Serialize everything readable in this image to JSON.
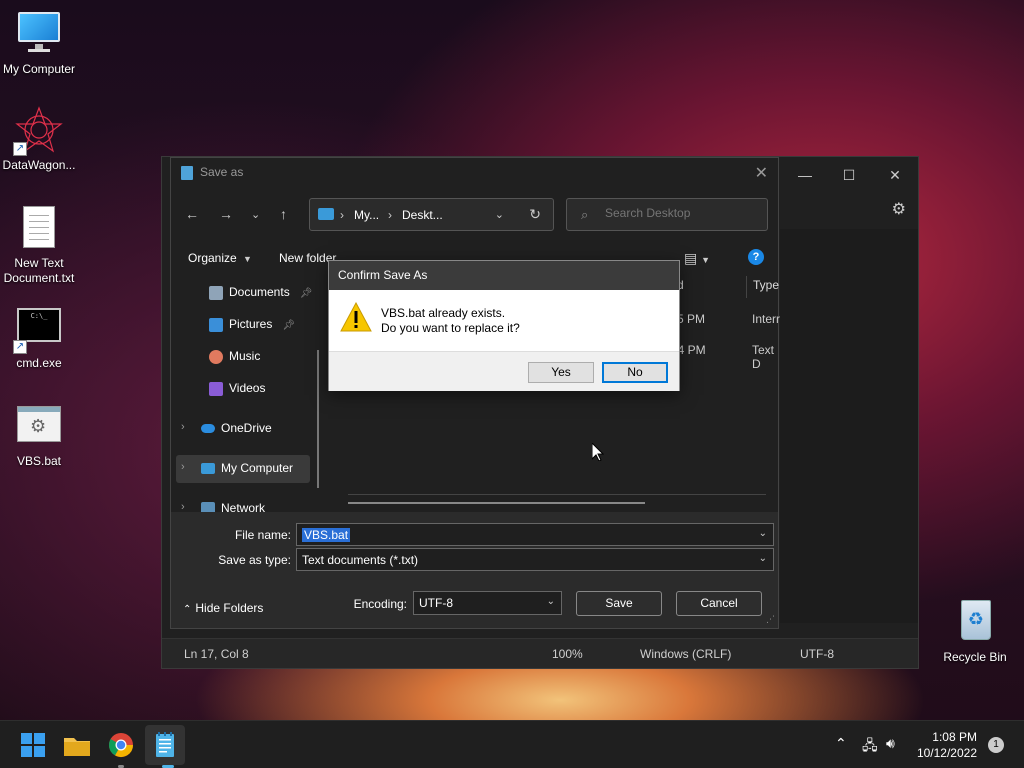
{
  "desktop": {
    "icons": [
      {
        "label": "My Computer"
      },
      {
        "label": "DataWagon..."
      },
      {
        "label": "New Text Document.txt"
      },
      {
        "label": "cmd.exe"
      },
      {
        "label": "VBS.bat"
      },
      {
        "label": "Recycle Bin"
      }
    ]
  },
  "notepad": {
    "status": {
      "position": "Ln 17, Col 8",
      "zoom": "100%",
      "line_ending": "Windows (CRLF)",
      "encoding": "UTF-8"
    }
  },
  "save_as": {
    "title": "Save as",
    "address": {
      "seg1": "My...",
      "seg2": "Deskt..."
    },
    "search_placeholder": "Search Desktop",
    "organize": "Organize",
    "new_folder": "New folder",
    "nav": {
      "documents": "Documents",
      "pictures": "Pictures",
      "music": "Music",
      "videos": "Videos",
      "onedrive": "OneDrive",
      "my_computer": "My Computer",
      "network": "Network"
    },
    "columns": {
      "modified_tail": "d",
      "type": "Type"
    },
    "rows": [
      {
        "time": "5 PM",
        "type": "Interr"
      },
      {
        "time": "04 PM",
        "type": "Text D"
      }
    ],
    "file_name_label": "File name:",
    "file_name_value": "VBS.bat",
    "save_type_label": "Save as type:",
    "save_type_value": "Text documents (*.txt)",
    "encoding_label": "Encoding:",
    "encoding_value": "UTF-8",
    "save_btn": "Save",
    "cancel_btn": "Cancel",
    "hide_folders": "Hide Folders"
  },
  "confirm": {
    "title": "Confirm Save As",
    "line1": "VBS.bat already exists.",
    "line2": "Do you want to replace it?",
    "yes": "Yes",
    "no": "No"
  },
  "taskbar": {
    "time": "1:08 PM",
    "date": "10/12/2022",
    "notif_count": "1"
  },
  "colors": {
    "accent": "#0078d7",
    "selection": "#2a6fd6",
    "dialog_bg": "#202020"
  }
}
